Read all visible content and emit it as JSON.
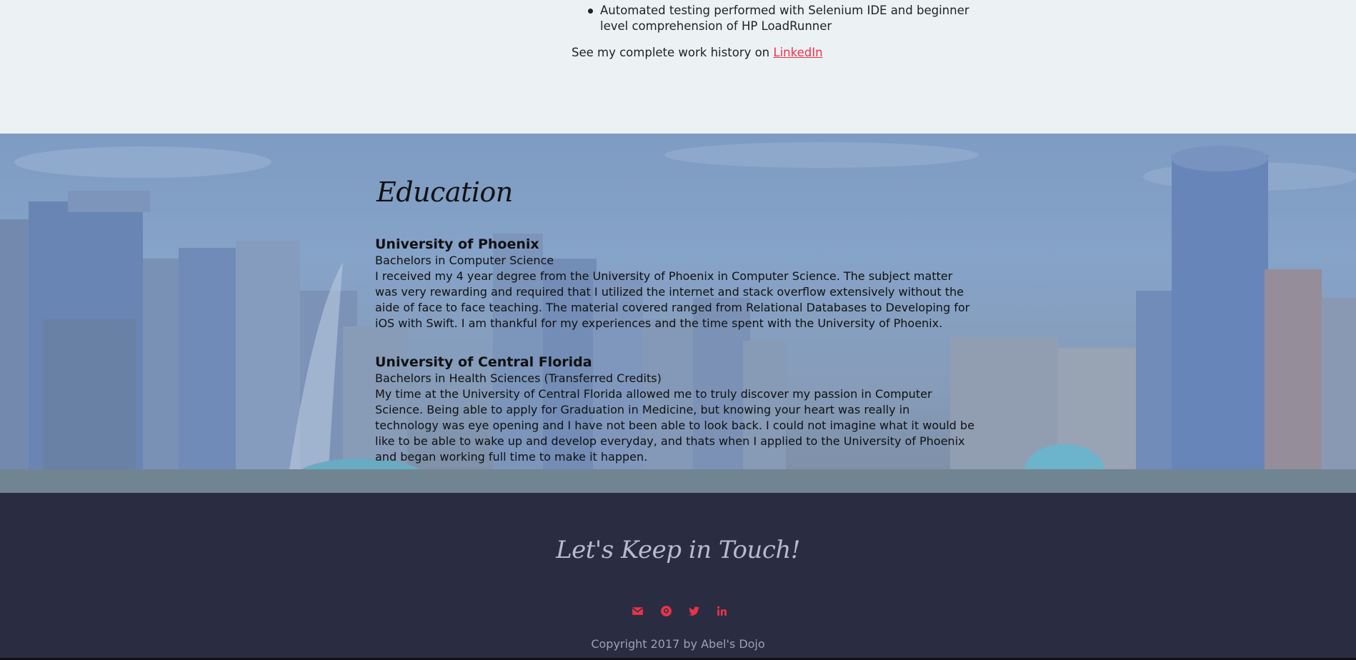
{
  "work": {
    "bullets": [
      "Automated testing performed with Selenium IDE and beginner level comprehension of HP LoadRunner"
    ],
    "history_text": "See my complete work history on ",
    "history_link": "LinkedIn"
  },
  "education": {
    "title": "Education",
    "schools": [
      {
        "name": "University of Phoenix",
        "degree": "Bachelors in Computer Science",
        "description": "I received my 4 year degree from the University of Phoenix in Computer Science. The subject matter was very rewarding and required that I utilized the internet and stack overflow extensively without the aide of face to face teaching. The material covered ranged from Relational Databases to Developing for iOS with Swift. I am thankful for my experiences and the time spent with the University of Phoenix."
      },
      {
        "name": "University of Central Florida",
        "degree": "Bachelors in Health Sciences (Transferred Credits)",
        "description": "My time at the University of Central Florida allowed me to truly discover my passion in Computer Science. Being able to apply for Graduation in Medicine, but knowing your heart was really in technology was eye opening and I have not been able to look back. I could not imagine what it would be like to be able to wake up and develop everyday, and thats when I applied to the University of Phoenix and began working full time to make it happen."
      }
    ]
  },
  "footer": {
    "title": "Let's Keep in Touch!",
    "social_icons": [
      "envelope-icon",
      "github-icon",
      "twitter-icon",
      "linkedin-icon"
    ],
    "copyright": "Copyright 2017 by Abel's Dojo"
  },
  "colors": {
    "accent": "#e8334a",
    "footer_bg": "#2a2c42",
    "page_bg": "#ecf1f4"
  }
}
